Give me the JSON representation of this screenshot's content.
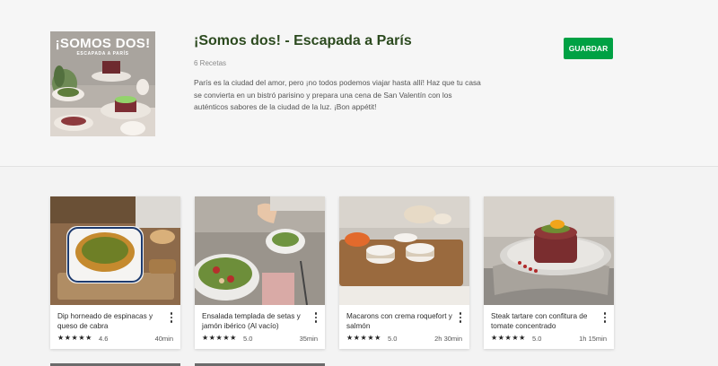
{
  "collection": {
    "cover": {
      "title": "¡SOMOS DOS!",
      "subtitle": "ESCAPADA A PARÍS"
    },
    "title": "¡Somos dos! - Escapada a París",
    "recipe_count": "6 Recetas",
    "description": "París es la ciudad del amor, pero ¡no todos podemos viajar hasta allí! Haz que tu casa se convierta en un bistró parisino y prepara una cena de San Valentín con los auténticos sabores de la ciudad de la luz. ¡Bon appétit!",
    "save_label": "GUARDAR"
  },
  "recipes": [
    {
      "title": "Dip horneado de espinacas y queso de cabra",
      "stars": "★★★★★",
      "rating": "4.6",
      "time": "40min"
    },
    {
      "title": "Ensalada templada de setas y jamón ibérico (Al vacío)",
      "stars": "★★★★★",
      "rating": "5.0",
      "time": "35min"
    },
    {
      "title": "Macarons con crema roquefort y salmón",
      "stars": "★★★★★",
      "rating": "5.0",
      "time": "2h 30min"
    },
    {
      "title": "Steak tartare con confitura de tomate concentrado",
      "stars": "★★★★★",
      "rating": "5.0",
      "time": "1h 15min"
    }
  ],
  "colors": {
    "brand_green": "#00a144",
    "title_green": "#2c4a1f"
  }
}
